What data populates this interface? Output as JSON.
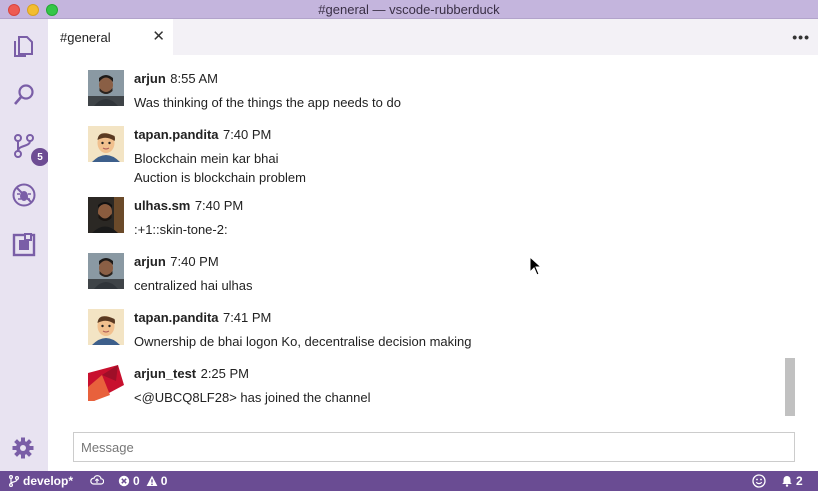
{
  "window": {
    "title": "#general — vscode-rubberduck"
  },
  "activity_bar": {
    "source_control_badge": "5"
  },
  "tab": {
    "label": "#general",
    "close_glyph": "✕",
    "more_glyph": "•••"
  },
  "messages": [
    {
      "author": "arjun",
      "time": "8:55 AM",
      "lines": [
        "Was thinking of the things the app needs to do"
      ],
      "avatar": "photo-man-beard"
    },
    {
      "author": "tapan.pandita",
      "time": "7:40 PM",
      "lines": [
        "Blockchain mein kar bhai",
        "Auction is blockchain problem"
      ],
      "avatar": "cartoon-man"
    },
    {
      "author": "ulhas.sm",
      "time": "7:40 PM",
      "lines": [
        ":+1::skin-tone-2:"
      ],
      "avatar": "photo-man-dark"
    },
    {
      "author": "arjun",
      "time": "7:40 PM",
      "lines": [
        "centralized hai ulhas"
      ],
      "avatar": "photo-man-beard"
    },
    {
      "author": "tapan.pandita",
      "time": "7:41 PM",
      "lines": [
        "Ownership de bhai logon Ko, decentralise decision making"
      ],
      "avatar": "cartoon-man"
    },
    {
      "author": "arjun_test",
      "time": "2:25 PM",
      "lines": [
        "<@UBCQ8LF28> has joined the channel"
      ],
      "avatar": "red-geometric"
    }
  ],
  "composer": {
    "placeholder": "Message"
  },
  "status_bar": {
    "branch": "develop*",
    "errors": "0",
    "warnings": "0",
    "notifications": "2"
  },
  "colors": {
    "title_bar": "#c4b5dd",
    "activity_bar": "#e8e3f1",
    "status_bar": "#6a4c93",
    "accent": "#6d4c93"
  }
}
